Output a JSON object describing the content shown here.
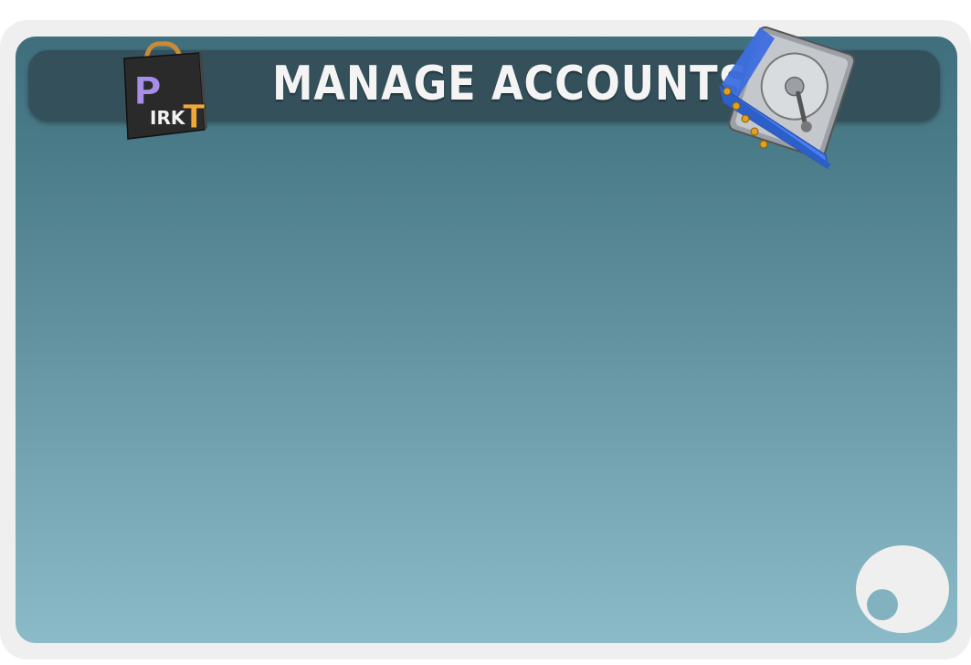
{
  "header": {
    "title": "MANAGE ACCOUNTS",
    "logo": {
      "icon": "shopping-bag-logo-icon",
      "letters": [
        "P",
        "IRK",
        "T"
      ],
      "colors": {
        "bag": "#2b2b2b",
        "letters_purple": "#a78ee8",
        "letters_gold": "#f0a838",
        "handle": "#c98a3a"
      }
    },
    "drive_icon": "hard-drive-icon"
  },
  "corner_button_icon": "circle-orb-icon",
  "colors": {
    "frame": "#efefef",
    "panel_top": "#3f6f7d",
    "panel_bottom": "#8bbac8",
    "title_bar": "#34505a",
    "title_text": "#f4f4f4"
  }
}
